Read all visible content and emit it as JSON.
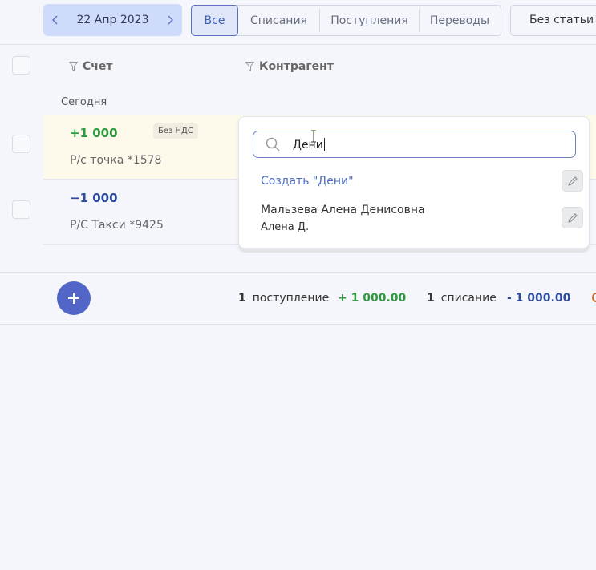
{
  "toolbar": {
    "date": "22 Апр 2023",
    "tabs": [
      {
        "label": "Все",
        "active": true
      },
      {
        "label": "Списания",
        "active": false
      },
      {
        "label": "Поступления",
        "active": false
      },
      {
        "label": "Переводы",
        "active": false
      }
    ],
    "article_filter": "Без статьи (С"
  },
  "table": {
    "columns": {
      "account": "Счет",
      "counterparty": "Контрагент"
    },
    "section_label": "Сегодня",
    "rows": [
      {
        "amount": "+1 000",
        "account": "Р/с точка *1578",
        "vat_badge": "Без НДС",
        "type": "income"
      },
      {
        "amount": "−1 000",
        "account": "Р/С Такси *9425",
        "type": "expense"
      }
    ]
  },
  "dropdown": {
    "search_value": "Дени",
    "create_label": "Создать \"Дени\"",
    "results": [
      {
        "name": "Мальзева Алена Денисовна",
        "short": "Алена Д."
      }
    ]
  },
  "footer": {
    "income_count": "1",
    "income_label": "поступление",
    "income_total": "+ 1 000.00",
    "expense_count": "1",
    "expense_label": "списание",
    "expense_total": "- 1 000.00"
  },
  "colors": {
    "accent": "#5166c6",
    "income": "#2e9a3e",
    "expense": "#2d4ca0",
    "date_pill": "#cfdbfb",
    "highlight_row": "#fdfaec"
  }
}
